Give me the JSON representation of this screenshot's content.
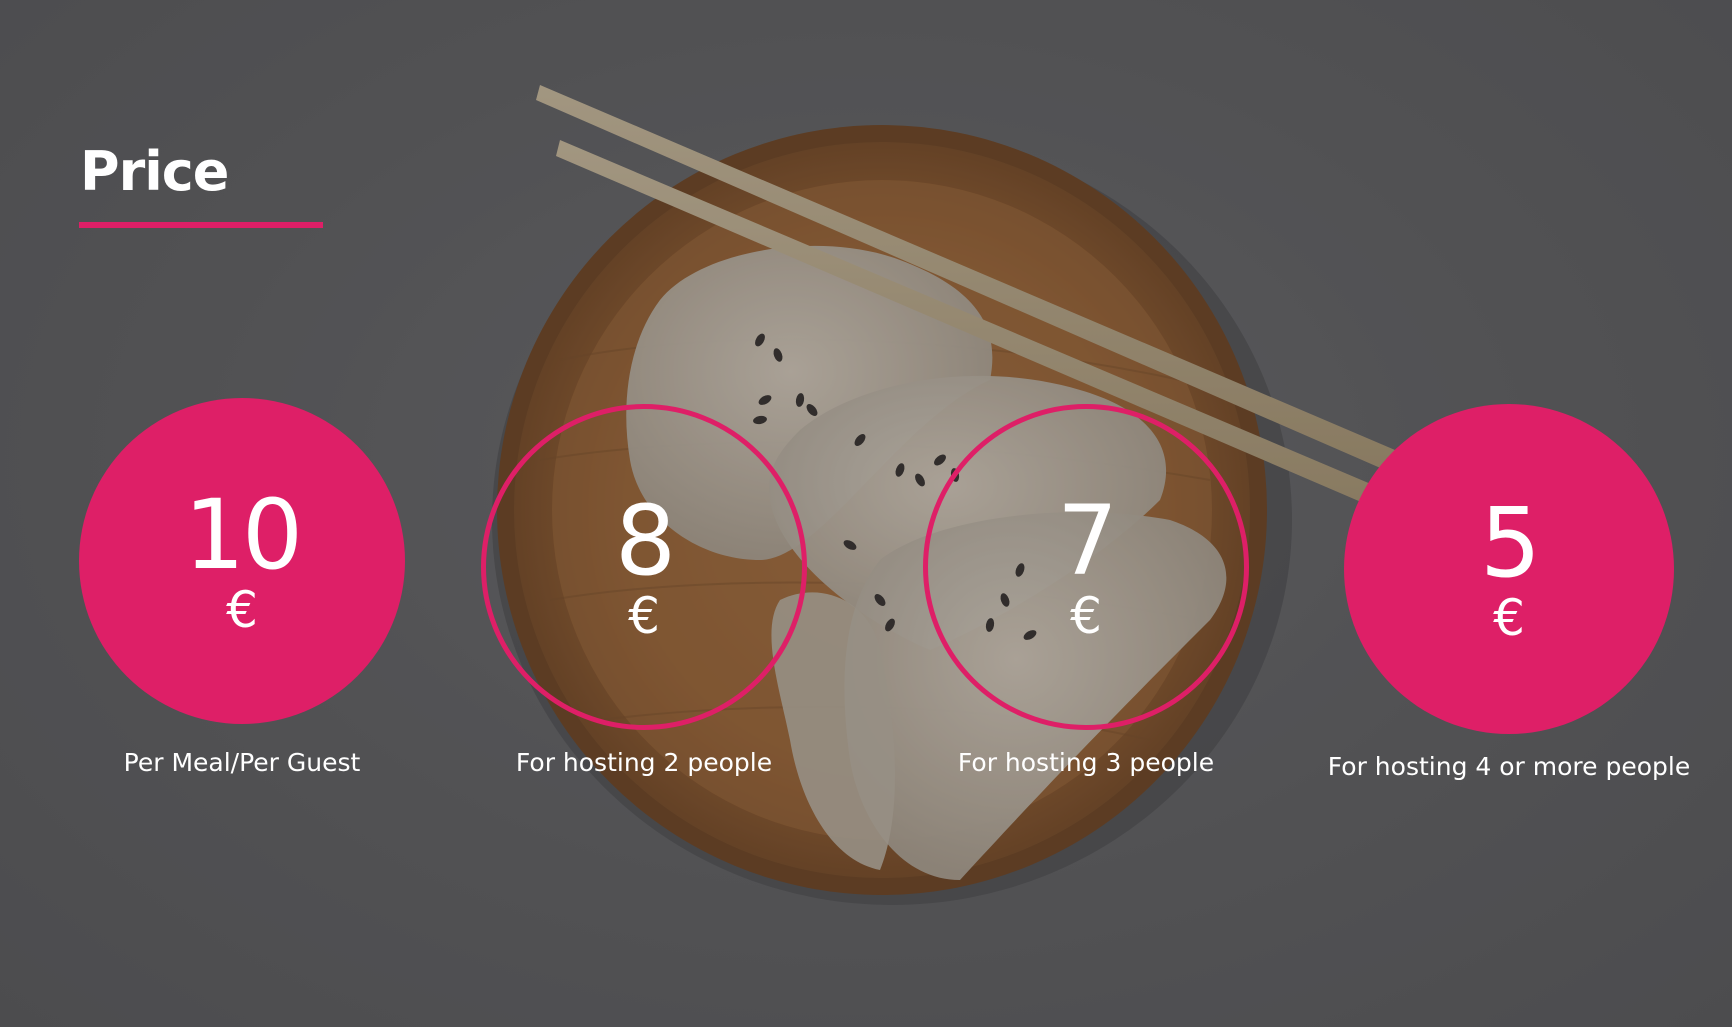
{
  "page": {
    "title": "Price",
    "accent_color": "#de1f67",
    "background_color": "#5c5c5e",
    "background_image": "dumplings-on-wooden-plate-with-chopsticks"
  },
  "prices": [
    {
      "amount": "10",
      "currency": "€",
      "caption": "Per Meal/Per Guest",
      "style": "filled"
    },
    {
      "amount": "8",
      "currency": "€",
      "caption": "For hosting 2 people",
      "style": "outline"
    },
    {
      "amount": "7",
      "currency": "€",
      "caption": "For hosting 3 people",
      "style": "outline"
    },
    {
      "amount": "5",
      "currency": "€",
      "caption": "For hosting 4 or more people",
      "style": "filled"
    }
  ]
}
